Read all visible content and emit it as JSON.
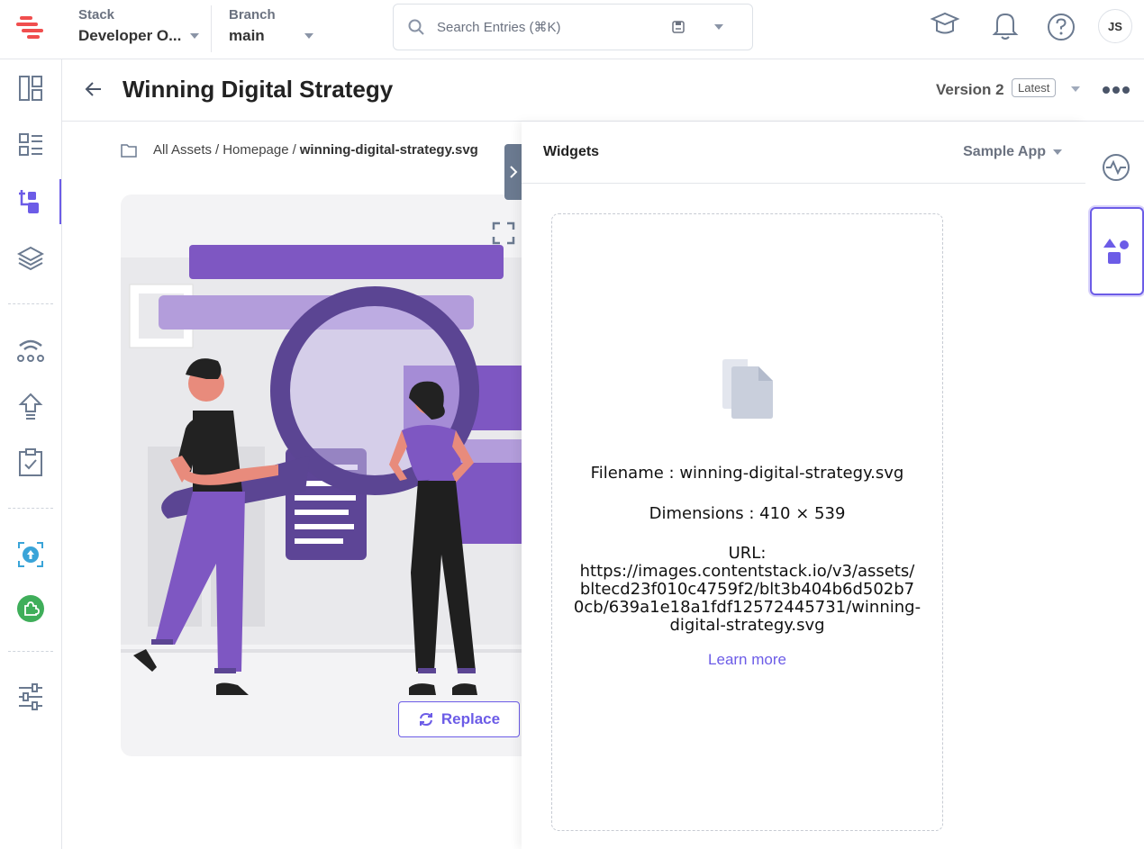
{
  "topbar": {
    "stack_label": "Stack",
    "stack_value": "Developer O...",
    "branch_label": "Branch",
    "branch_value": "main",
    "search_placeholder": "Search Entries (⌘K)",
    "avatar": "JS"
  },
  "header": {
    "title": "Winning Digital Strategy",
    "version": "Version 2",
    "badge": "Latest"
  },
  "breadcrumb": {
    "items": [
      "All Assets",
      "Homepage"
    ],
    "separator": "/",
    "current": "winning-digital-strategy.svg"
  },
  "asset": {
    "replace_label": "Replace"
  },
  "panel": {
    "title": "Widgets",
    "app_select": "Sample App",
    "filename_line": "Filename : winning-digital-strategy.svg",
    "dimensions_line": "Dimensions : 410 × 539",
    "url_label": "URL:",
    "url_lines": [
      "https://images.contentstack.io/v3/assets/",
      "bltecd23f010c4759f2/blt3b404b6d502b7",
      "0cb/639a1e18a1fdf12572445731/winning-",
      "digital-strategy.svg"
    ],
    "learn_more": "Learn more"
  },
  "colors": {
    "accent": "#6c5ce7",
    "illustration_purple": "#7e57c2",
    "brand_red": "#f04e4e"
  }
}
